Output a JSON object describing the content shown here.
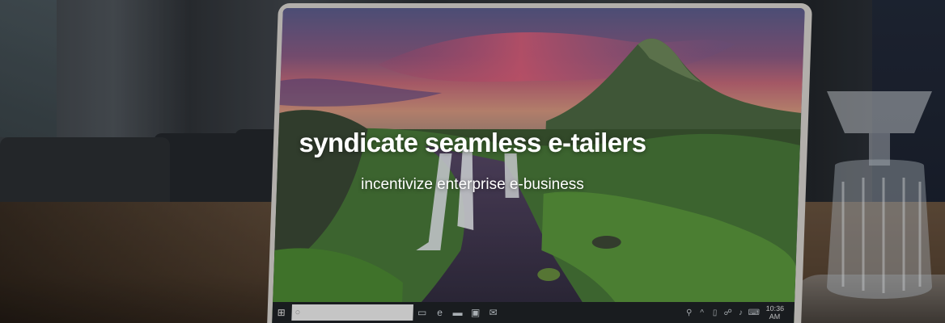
{
  "hero": {
    "heading": "syndicate seamless e-tailers",
    "subheading": "incentivize enterprise e-business"
  },
  "taskbar": {
    "start_icon": "windows-start-icon",
    "apps": [
      "edge-icon",
      "folder-icon",
      "store-icon",
      "mail-icon"
    ],
    "clock_time": "10:36 AM"
  },
  "colors": {
    "text": "#ffffff",
    "overlay": "rgba(0,0,0,0.18)"
  }
}
